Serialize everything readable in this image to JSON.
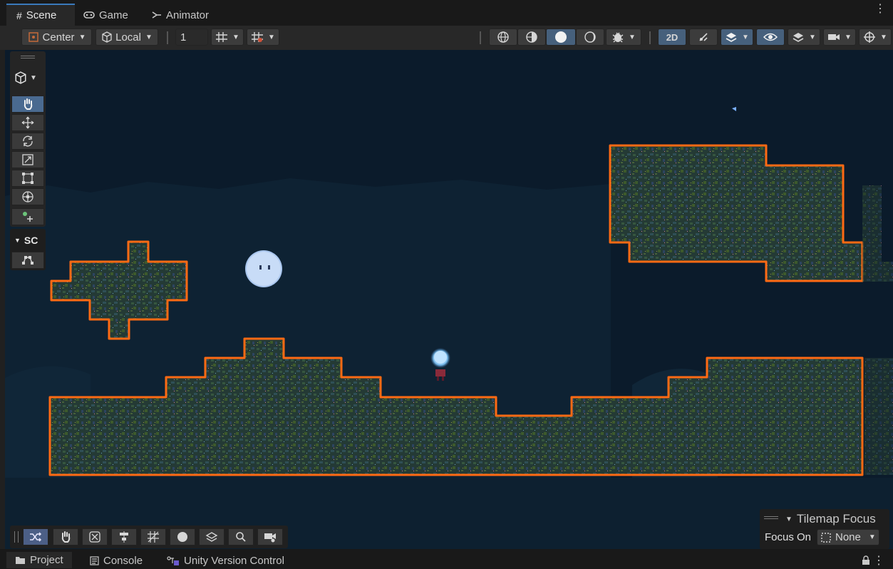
{
  "tabs": [
    {
      "label": "Scene",
      "icon": "grid-icon"
    },
    {
      "label": "Game",
      "icon": "gamepad-icon"
    },
    {
      "label": "Animator",
      "icon": "animator-icon"
    }
  ],
  "toolbar": {
    "pivot_label": "Center",
    "space_label": "Local",
    "grid_size_value": "1",
    "mode_2d_label": "2D"
  },
  "tool_overlay": {
    "section_label": "SC",
    "active_tool": "hand"
  },
  "tilemap_focus": {
    "title": "Tilemap Focus",
    "focus_on_label": "Focus On",
    "focus_value": "None"
  },
  "bottom_tabs": [
    {
      "label": "Project",
      "icon": "folder-icon"
    },
    {
      "label": "Console",
      "icon": "console-icon"
    },
    {
      "label": "Unity Version Control",
      "icon": "version-control-icon"
    }
  ],
  "colors": {
    "accent": "#3a79bb",
    "tile_outline": "#ff6a13",
    "scene_bg": "#0b1b2b",
    "tile_fill": "#2b4a3c"
  }
}
